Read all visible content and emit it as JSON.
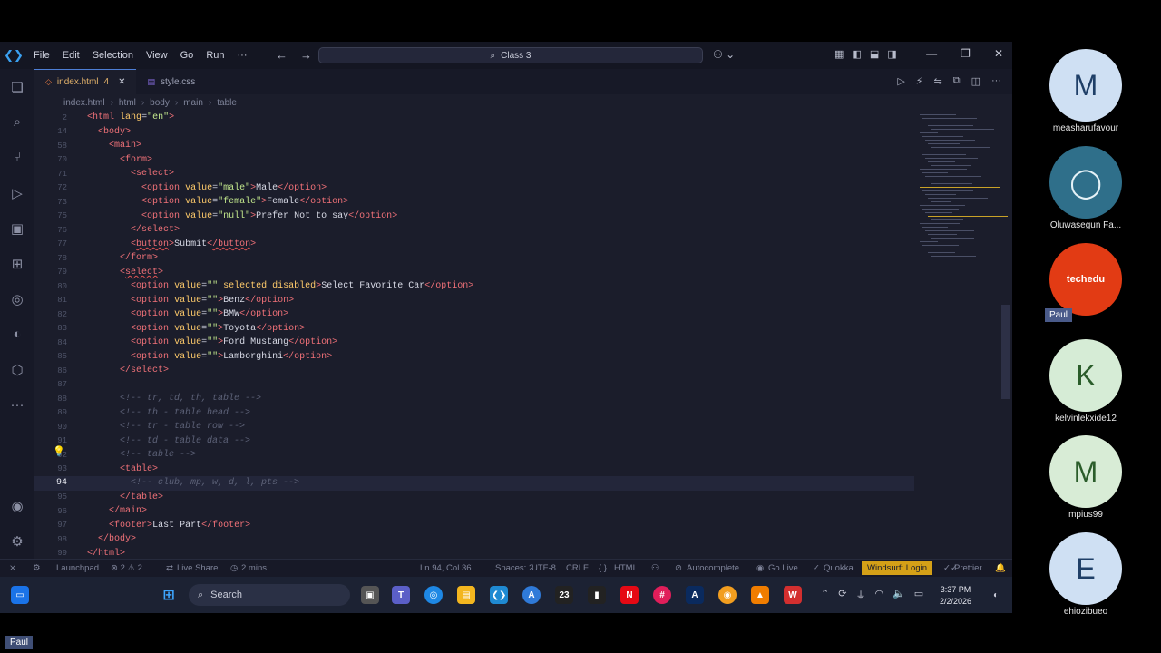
{
  "titlebar": {
    "menu": [
      "File",
      "Edit",
      "Selection",
      "View",
      "Go",
      "Run",
      "···"
    ],
    "search": "Class 3"
  },
  "tabs": [
    {
      "label": "index.html",
      "badge": "4"
    },
    {
      "label": "style.css"
    }
  ],
  "breadcrumb": [
    "index.html",
    "html",
    "body",
    "main",
    "table"
  ],
  "editor": {
    "current_line": "94",
    "lines": [
      {
        "n": "2",
        "code": "<html lang=\"en\">"
      },
      {
        "n": "14",
        "code": "  <body>"
      },
      {
        "n": "58",
        "code": "    <main>"
      },
      {
        "n": "70",
        "code": "      <form>"
      },
      {
        "n": "71",
        "code": "        <select>"
      },
      {
        "n": "72",
        "code": "          <option value=\"male\">Male</option>"
      },
      {
        "n": "73",
        "code": "          <option value=\"female\">Female</option>"
      },
      {
        "n": "75",
        "code": "          <option value=\"null\">Prefer Not to say</option>"
      },
      {
        "n": "76",
        "code": "        </select>"
      },
      {
        "n": "77",
        "code": "        <button>Submit</button>"
      },
      {
        "n": "78",
        "code": "      </form>"
      },
      {
        "n": "79",
        "code": "      <select>"
      },
      {
        "n": "80",
        "code": "        <option value=\"\" selected disabled>Select Favorite Car</option>"
      },
      {
        "n": "81",
        "code": "        <option value=\"\">Benz</option>"
      },
      {
        "n": "82",
        "code": "        <option value=\"\">BMW</option>"
      },
      {
        "n": "83",
        "code": "        <option value=\"\">Toyota</option>"
      },
      {
        "n": "84",
        "code": "        <option value=\"\">Ford Mustang</option>"
      },
      {
        "n": "85",
        "code": "        <option value=\"\">Lamborghini</option>"
      },
      {
        "n": "86",
        "code": "      </select>"
      },
      {
        "n": "87",
        "code": ""
      },
      {
        "n": "88",
        "code": "      <!-- tr, td, th, table -->"
      },
      {
        "n": "89",
        "code": "      <!-- th - table head -->"
      },
      {
        "n": "90",
        "code": "      <!-- tr - table row -->"
      },
      {
        "n": "91",
        "code": "      <!-- td - table data -->"
      },
      {
        "n": "92",
        "code": "      <!-- table -->"
      },
      {
        "n": "93",
        "code": "      <table>"
      },
      {
        "n": "94",
        "code": "        <!-- club, mp, w, d, l, pts -->"
      },
      {
        "n": "95",
        "code": "      </table>"
      },
      {
        "n": "96",
        "code": "    </main>"
      },
      {
        "n": "97",
        "code": "    <footer>Last Part</footer>"
      },
      {
        "n": "98",
        "code": "  </body>"
      },
      {
        "n": "99",
        "code": "</html>"
      }
    ]
  },
  "statusbar": {
    "launchpad": "Launchpad",
    "problems": "⊗ 2 ⚠ 2",
    "liveshare": "Live Share",
    "timer": "2 mins",
    "position": "Ln 94, Col 36",
    "spaces": "Spaces: 2",
    "encoding": "UTF-8",
    "eol": "CRLF",
    "language": "HTML",
    "autocomplete": "Autocomplete",
    "golive": "Go Live",
    "quokka": "Quokka",
    "windsurf": "Windsurf: Login",
    "prettier": "Prettier"
  },
  "taskbar": {
    "search": "Search",
    "time": "3:37 PM",
    "date": "2/2/2026"
  },
  "participants": [
    {
      "initial": "M",
      "name": "measharufavour",
      "bg": "#cfe0f3"
    },
    {
      "initial": "",
      "name": "Oluwasegun Fa...",
      "bg": "#2f6f8a"
    },
    {
      "initial": "techedu",
      "name": "",
      "bg": "#e23b14"
    },
    {
      "initial": "K",
      "name": "kelvinlekxide12",
      "bg": "#d6ecd6"
    },
    {
      "initial": "M",
      "name": "mpius99",
      "bg": "#d8ecd6"
    },
    {
      "initial": "E",
      "name": "ehiozibueo",
      "bg": "#cfe0f3"
    }
  ],
  "paul_label": "Paul",
  "self_label": "Paul"
}
